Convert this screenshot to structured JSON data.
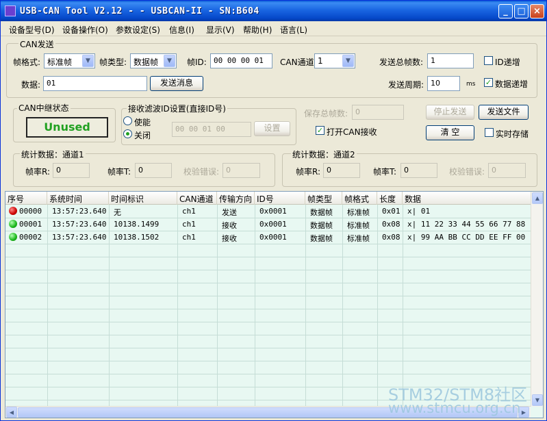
{
  "window": {
    "title": "USB-CAN Tool V2.12 -  - USBCAN-II - SN:B604"
  },
  "titlebar_buttons": {
    "minimize": "_",
    "maximize": "□",
    "close": "×"
  },
  "menu": [
    "设备型号(D)",
    "设备操作(O)",
    "参数设定(S)",
    "信息(I)",
    "显示(V)",
    "帮助(H)",
    "语言(L)"
  ],
  "can_send": {
    "group_title": "CAN发送",
    "frame_format_label": "帧格式:",
    "frame_format_value": "标准帧",
    "frame_type_label": "帧类型:",
    "frame_type_value": "数据帧",
    "frame_id_label": "帧ID:",
    "frame_id_value": "00 00 00 01",
    "can_channel_label": "CAN通道:",
    "can_channel_value": "1",
    "send_total_label": "发送总帧数:",
    "send_total_value": "1",
    "id_increment_label": "ID递增",
    "id_increment_checked": false,
    "data_label": "数据:",
    "data_value": "01",
    "send_button": "发送消息",
    "send_period_label": "发送周期:",
    "send_period_value": "10",
    "send_period_unit": "ms",
    "data_increment_label": "数据递增",
    "data_increment_checked": true
  },
  "relay": {
    "group_title": "CAN中继状态",
    "status": "Unused"
  },
  "filter": {
    "group_title": "接收滤波ID设置(直接ID号)",
    "enable_label": "使能",
    "disable_label": "关闭",
    "selected": "disable",
    "id_value": "00 00 01 00",
    "set_button": "设置"
  },
  "controls": {
    "save_total_label": "保存总帧数:",
    "save_total_value": "0",
    "stop_send_button": "停止发送",
    "send_file_button": "发送文件",
    "open_receive_label": "打开CAN接收",
    "open_receive_checked": true,
    "clear_button": "清 空",
    "realtime_save_label": "实时存储",
    "realtime_save_checked": false
  },
  "stats1": {
    "title": "统计数据：通道1",
    "rx_label": "帧率R:",
    "rx_value": "0",
    "tx_label": "帧率T:",
    "tx_value": "0",
    "err_label": "校验错误:",
    "err_value": "0"
  },
  "stats2": {
    "title": "统计数据：通道2",
    "rx_label": "帧率R:",
    "rx_value": "0",
    "tx_label": "帧率T:",
    "tx_value": "0",
    "err_label": "校验错误:",
    "err_value": "0"
  },
  "table": {
    "columns": [
      "序号",
      "系统时间",
      "时间标识",
      "CAN通道",
      "传输方向",
      "ID号",
      "帧类型",
      "帧格式",
      "长度",
      "数据"
    ],
    "rows": [
      {
        "status": "red",
        "cells": [
          "00000",
          "13:57:23.640",
          "无",
          "ch1",
          "发送",
          "0x0001",
          "数据帧",
          "标准帧",
          "0x01",
          "x| 01"
        ]
      },
      {
        "status": "green",
        "cells": [
          "00001",
          "13:57:23.640",
          "10138.1499",
          "ch1",
          "接收",
          "0x0001",
          "数据帧",
          "标准帧",
          "0x08",
          "x| 11 22 33 44 55 66 77 88"
        ]
      },
      {
        "status": "green",
        "cells": [
          "00002",
          "13:57:23.640",
          "10138.1502",
          "ch1",
          "接收",
          "0x0001",
          "数据帧",
          "标准帧",
          "0x08",
          "x| 99 AA BB CC DD EE FF 00"
        ]
      }
    ]
  },
  "watermark": {
    "line1": "STM32/STM8社区",
    "line2": "www.stmcu.org.cn"
  }
}
